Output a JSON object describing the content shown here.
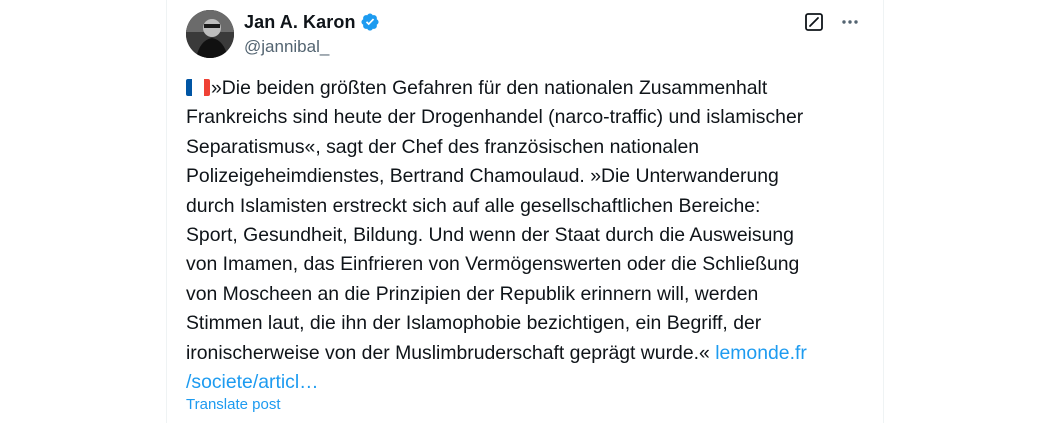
{
  "post": {
    "author": {
      "display_name": "Jan A. Karon",
      "handle": "@jannibal_",
      "verified": true
    },
    "actions": {
      "edit_icon": "edit-icon",
      "more_icon": "more-icon"
    },
    "flag_icon": "france-flag-emoji",
    "text_lines": [
      "»Die beiden größten Gefahren für den nationalen Zusammenhalt",
      "Frankreichs sind heute der Drogenhandel (narco-traffic) und islamischer",
      "Separatismus«, sagt der Chef des französischen nationalen",
      "Polizeigeheimdienstes, Bertrand Chamoulaud. »Die Unterwanderung",
      "durch Islamisten erstreckt sich auf alle gesellschaftlichen Bereiche:",
      "Sport, Gesundheit, Bildung. Und wenn der Staat durch die Ausweisung",
      "von Imamen, das Einfrieren von Vermögenswerten oder die Schließung",
      "von Moscheen an die Prinzipien der Republik erinnern will, werden",
      "Stimmen laut, die ihn der Islamophobie bezichtigen, ein Begriff, der",
      "ironischerweise von der Muslimbruderschaft geprägt wurde.« "
    ],
    "link": {
      "line1": "lemonde.fr",
      "line2": "/societe/articl…"
    },
    "translate_label": "Translate post"
  },
  "colors": {
    "accent": "#1d9bf0",
    "text": "#0f1419",
    "secondary": "#536471"
  }
}
